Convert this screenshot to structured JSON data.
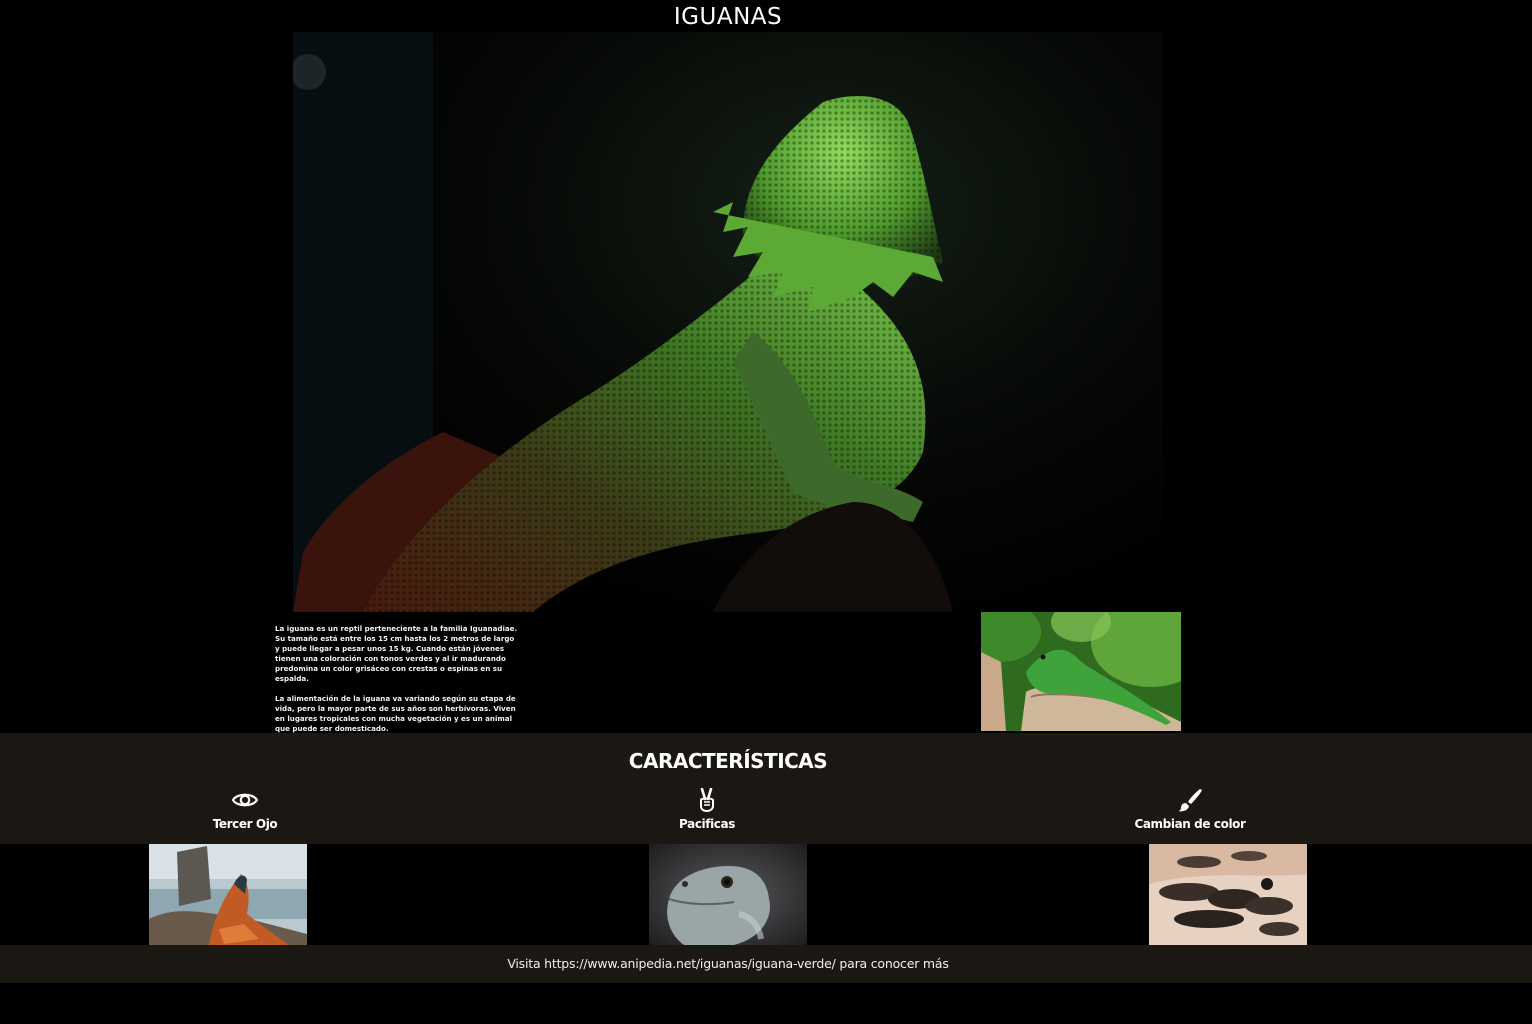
{
  "header": {
    "title": "IGUANAS"
  },
  "hero": {
    "image": "green-lizard-photo"
  },
  "intro": {
    "paragraphs": [
      "La iguana es un reptil perteneciente a la familia Iguanadiae. Su tamaño está entre los 15 cm hasta los 2 metros de largo y puede llegar a pesar unos 15 kg. Cuando están jóvenes tienen una coloración con tonos verdes y al ir madurando predomina un color grisáceo con crestas o espinas en su espalda.",
      "La alimentación de la iguana va variando según su etapa de vida, pero la mayor parte de sus años son herbívoras. Viven en lugares tropicales con mucha vegetación y es un animal que puede ser domesticado."
    ],
    "side_image": "iguana-on-stump-photo"
  },
  "features": {
    "title": "CARACTERÍSTICAS",
    "items": [
      {
        "label": "Tercer Ojo",
        "icon": "eye-icon",
        "image": "orange-iguana-photo"
      },
      {
        "label": "Pacificas",
        "icon": "peace-hand-icon",
        "image": "iguana-head-photo"
      },
      {
        "label": "Cambian de color",
        "icon": "paintbrush-icon",
        "image": "marine-iguanas-photo"
      }
    ]
  },
  "footer": {
    "text": "Visita https://www.anipedia.net/iguanas/iguana-verde/ para conocer más"
  },
  "colors": {
    "background": "#000000",
    "band": "#1b1814",
    "text": "#ffffff"
  }
}
